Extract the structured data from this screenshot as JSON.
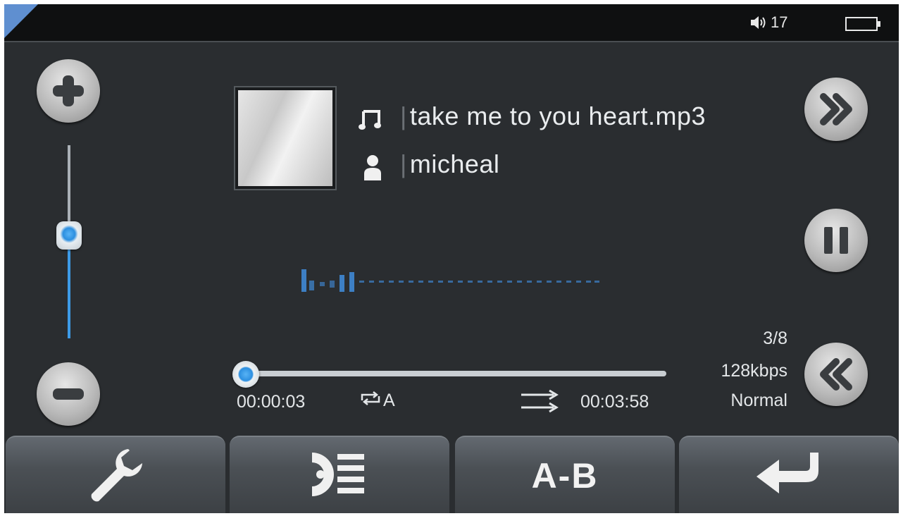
{
  "status_bar": {
    "volume_level": "17",
    "speaker_icon": "speaker-icon",
    "battery_icon": "battery-icon"
  },
  "volume": {
    "increase_icon": "plus-icon",
    "decrease_icon": "minus-icon",
    "level_fraction": 0.55
  },
  "track": {
    "title": "take me to you heart.mp3",
    "artist": "micheal",
    "title_icon": "music-note-icon",
    "artist_icon": "person-icon"
  },
  "playback": {
    "elapsed": "00:00:03",
    "total": "00:03:58",
    "repeat_mode": "A",
    "progress_fraction": 0.0,
    "track_position": "3/8",
    "bitrate": "128kbps",
    "eq_mode": "Normal"
  },
  "controls": {
    "next_icon": "fast-forward-icon",
    "pause_icon": "pause-icon",
    "previous_icon": "rewind-icon",
    "repeat_icon": "repeat-icon",
    "shuffle_icon": "shuffle-icon"
  },
  "bottom_bar": {
    "settings_icon": "wrench-icon",
    "playlist_icon": "playlist-icon",
    "ab_label": "A-B",
    "back_icon": "return-arrow-icon"
  },
  "colors": {
    "accent": "#3d9be8",
    "background": "#2a2d30",
    "status_bar": "#0f1011",
    "text": "#e9ecee"
  }
}
